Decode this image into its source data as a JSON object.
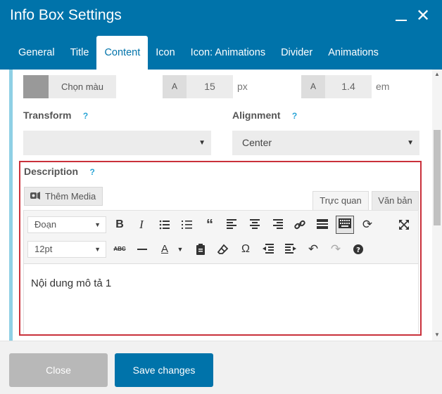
{
  "header": {
    "title": "Info Box Settings",
    "minimize_icon": "minimize-icon",
    "close_icon": "close-icon",
    "close_glyph": "✕"
  },
  "tabs": [
    {
      "label": "General"
    },
    {
      "label": "Title"
    },
    {
      "label": "Content",
      "active": true
    },
    {
      "label": "Icon"
    },
    {
      "label": "Icon: Animations"
    },
    {
      "label": "Divider"
    },
    {
      "label": "Animations"
    }
  ],
  "color_row": {
    "color_button": "Chọn màu",
    "font_size_prefix": "A",
    "font_size_value": "15",
    "font_size_unit": "px",
    "line_height_prefix": "A",
    "line_height_value": "1.4",
    "line_height_unit": "em"
  },
  "transform": {
    "label": "Transform",
    "help": "?",
    "value": ""
  },
  "alignment": {
    "label": "Alignment",
    "help": "?",
    "value": "Center"
  },
  "description": {
    "label": "Description",
    "help": "?",
    "media_button": "Thêm Media",
    "tab_visual": "Trực quan",
    "tab_text": "Văn bản",
    "format_select": "Đoạn",
    "size_select": "12pt",
    "content": "Nội dung mô tả 1"
  },
  "footer": {
    "close_label": "Close",
    "save_label": "Save changes"
  },
  "colors": {
    "accent": "#0073aa",
    "highlight_border": "#c9303a",
    "help": "#29a4d6"
  }
}
